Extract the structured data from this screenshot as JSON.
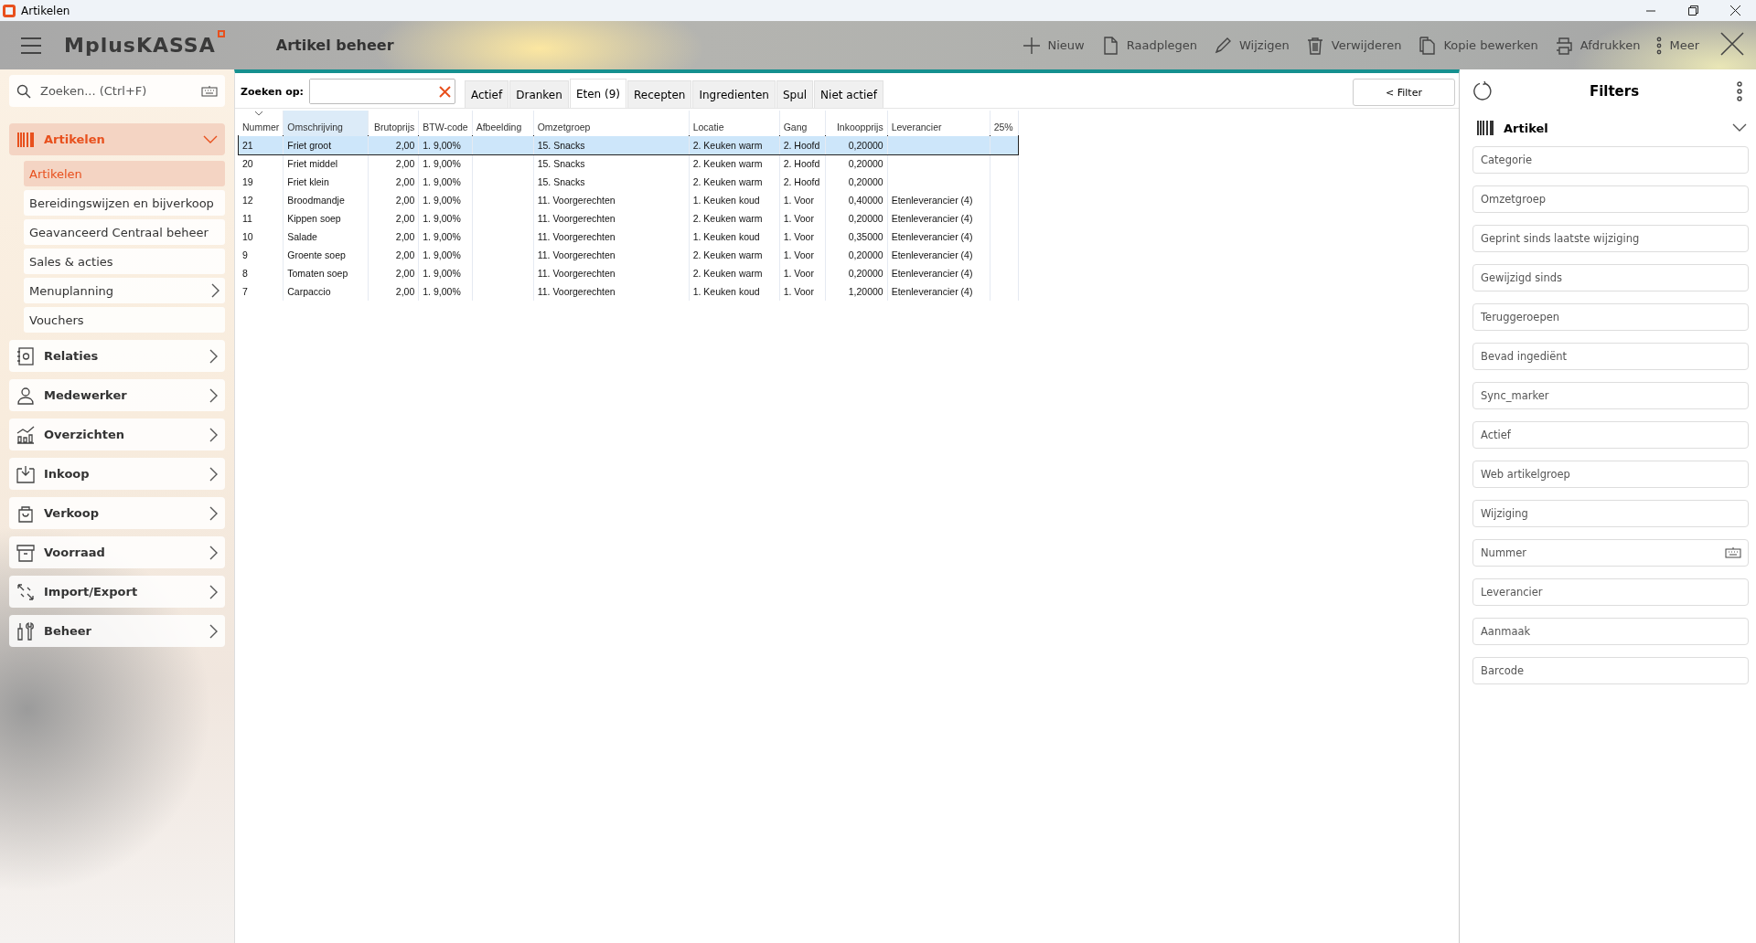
{
  "window": {
    "title": "Artikelen"
  },
  "header": {
    "logo": "MplusKASSA",
    "title": "Artikel beheer"
  },
  "toolbar": [
    "Nieuw",
    "Raadplegen",
    "Wijzigen",
    "Verwijderen",
    "Kopie bewerken",
    "Afdrukken",
    "Meer"
  ],
  "sidebar": {
    "search": {
      "placeholder": "Zoeken... (Ctrl+F)"
    },
    "items": [
      {
        "label": "Artikelen",
        "expanded": true,
        "children": [
          {
            "label": "Artikelen",
            "selected": true,
            "submenu": false
          },
          {
            "label": "Bereidingswijzen en bijverkoop",
            "selected": false,
            "submenu": false
          },
          {
            "label": "Geavanceerd Centraal beheer",
            "selected": false,
            "submenu": false
          },
          {
            "label": "Sales & acties",
            "selected": false,
            "submenu": false
          },
          {
            "label": "Menuplanning",
            "selected": false,
            "submenu": true
          },
          {
            "label": "Vouchers",
            "selected": false,
            "submenu": false
          }
        ]
      },
      {
        "label": "Relaties",
        "expanded": false
      },
      {
        "label": "Medewerker",
        "expanded": false
      },
      {
        "label": "Overzichten",
        "expanded": false
      },
      {
        "label": "Inkoop",
        "expanded": false
      },
      {
        "label": "Verkoop",
        "expanded": false
      },
      {
        "label": "Voorraad",
        "expanded": false
      },
      {
        "label": "Import/Export",
        "expanded": false
      },
      {
        "label": "Beheer",
        "expanded": false
      }
    ]
  },
  "search": {
    "label": "Zoeken op:"
  },
  "tabs": [
    {
      "label": "Actief",
      "selected": false
    },
    {
      "label": "Dranken",
      "selected": false
    },
    {
      "label": "Eten (9)",
      "selected": true
    },
    {
      "label": "Recepten",
      "selected": false
    },
    {
      "label": "Ingredienten",
      "selected": false
    },
    {
      "label": "Spul",
      "selected": false
    },
    {
      "label": "Niet actief",
      "selected": false
    }
  ],
  "filter_button": "< Filter",
  "table": {
    "columns": [
      {
        "label": "Nummer",
        "kind": "text",
        "sorted": true,
        "selected": false
      },
      {
        "label": "Omschrijving",
        "kind": "text",
        "sorted": false,
        "selected": true
      },
      {
        "label": "Brutoprijs",
        "kind": "number",
        "sorted": false,
        "selected": false
      },
      {
        "label": "BTW-code",
        "kind": "text",
        "sorted": false,
        "selected": false
      },
      {
        "label": "Afbeelding",
        "kind": "text",
        "sorted": false,
        "selected": false
      },
      {
        "label": "Omzetgroep",
        "kind": "text",
        "sorted": false,
        "selected": false
      },
      {
        "label": "Locatie",
        "kind": "text",
        "sorted": false,
        "selected": false
      },
      {
        "label": "Gang",
        "kind": "text",
        "sorted": false,
        "selected": false
      },
      {
        "label": "Inkoopprijs",
        "kind": "number",
        "sorted": false,
        "selected": false
      },
      {
        "label": "Leverancier",
        "kind": "text",
        "sorted": false,
        "selected": false
      },
      {
        "label": "25%",
        "kind": "text",
        "sorted": false,
        "selected": false
      }
    ],
    "rows": [
      {
        "selected": true,
        "cells": [
          "21",
          "Friet groot",
          "2,00",
          "1. 9,00%",
          "",
          "15. Snacks",
          "2. Keuken warm",
          "2. Hoofd",
          "0,20000",
          "",
          ""
        ]
      },
      {
        "selected": false,
        "cells": [
          "20",
          "Friet middel",
          "2,00",
          "1. 9,00%",
          "",
          "15. Snacks",
          "2. Keuken warm",
          "2. Hoofd",
          "0,20000",
          "",
          ""
        ]
      },
      {
        "selected": false,
        "cells": [
          "19",
          "Friet klein",
          "2,00",
          "1. 9,00%",
          "",
          "15. Snacks",
          "2. Keuken warm",
          "2. Hoofd",
          "0,20000",
          "",
          ""
        ]
      },
      {
        "selected": false,
        "cells": [
          "12",
          "Broodmandje",
          "2,00",
          "1. 9,00%",
          "",
          "11. Voorgerechten",
          "1. Keuken koud",
          "1. Voor",
          "0,40000",
          "Etenleverancier (4)",
          ""
        ]
      },
      {
        "selected": false,
        "cells": [
          "11",
          "Kippen soep",
          "2,00",
          "1. 9,00%",
          "",
          "11. Voorgerechten",
          "2. Keuken warm",
          "1. Voor",
          "0,20000",
          "Etenleverancier (4)",
          ""
        ]
      },
      {
        "selected": false,
        "cells": [
          "10",
          "Salade",
          "2,00",
          "1. 9,00%",
          "",
          "11. Voorgerechten",
          "1. Keuken koud",
          "1. Voor",
          "0,35000",
          "Etenleverancier (4)",
          ""
        ]
      },
      {
        "selected": false,
        "cells": [
          "9",
          "Groente soep",
          "2,00",
          "1. 9,00%",
          "",
          "11. Voorgerechten",
          "2. Keuken warm",
          "1. Voor",
          "0,20000",
          "Etenleverancier (4)",
          ""
        ]
      },
      {
        "selected": false,
        "cells": [
          "8",
          "Tomaten soep",
          "2,00",
          "1. 9,00%",
          "",
          "11. Voorgerechten",
          "2. Keuken warm",
          "1. Voor",
          "0,20000",
          "Etenleverancier (4)",
          ""
        ]
      },
      {
        "selected": false,
        "cells": [
          "7",
          "Carpaccio",
          "2,00",
          "1. 9,00%",
          "",
          "11. Voorgerechten",
          "1. Keuken koud",
          "1. Voor",
          "1,20000",
          "Etenleverancier (4)",
          ""
        ]
      }
    ]
  },
  "filters": {
    "title": "Filters",
    "section": {
      "label": "Artikel",
      "expanded": true
    },
    "fields": [
      {
        "placeholder": "Categorie",
        "keyboard": false
      },
      {
        "placeholder": "Omzetgroep",
        "keyboard": false
      },
      {
        "placeholder": "Geprint sinds laatste wijziging",
        "keyboard": false
      },
      {
        "placeholder": "Gewijzigd sinds",
        "keyboard": false
      },
      {
        "placeholder": "Teruggeroepen",
        "keyboard": false
      },
      {
        "placeholder": "Bevad ingediënt",
        "keyboard": false
      },
      {
        "placeholder": "Sync_marker",
        "keyboard": false
      },
      {
        "placeholder": "Actief",
        "keyboard": false
      },
      {
        "placeholder": "Web artikelgroep",
        "keyboard": false
      },
      {
        "placeholder": "Wijziging",
        "keyboard": false
      },
      {
        "placeholder": "Nummer",
        "keyboard": true
      },
      {
        "placeholder": "Leverancier",
        "keyboard": false
      },
      {
        "placeholder": "Aanmaak",
        "keyboard": false
      },
      {
        "placeholder": "Barcode",
        "keyboard": false
      }
    ]
  }
}
